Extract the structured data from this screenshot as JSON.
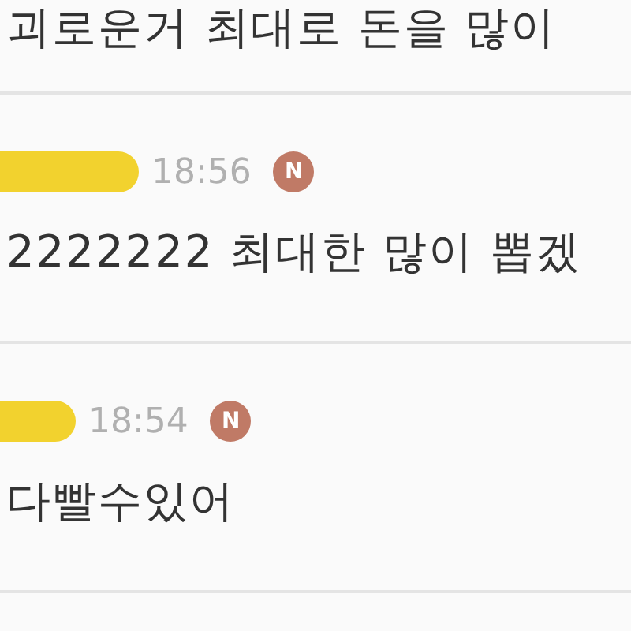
{
  "comments": [
    {
      "text": "괴로운거 최대로 돈을 많이"
    },
    {
      "time": "18:56",
      "badge": "N",
      "text": "2222222 최대한 많이 뽑겠"
    },
    {
      "time": "18:54",
      "badge": "N",
      "text": "다빨수있어"
    }
  ]
}
